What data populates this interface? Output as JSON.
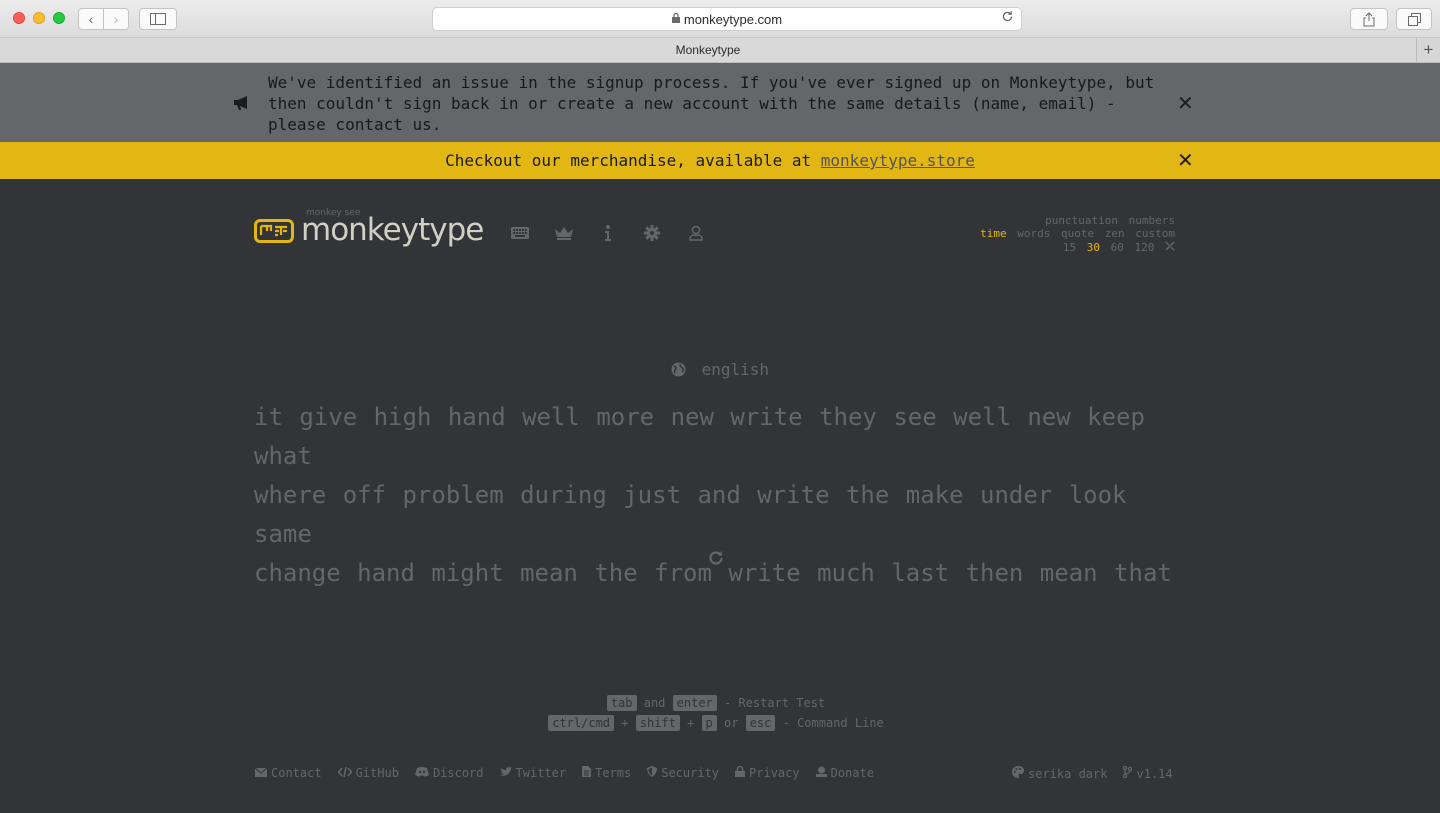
{
  "browser": {
    "url": "monkeytype.com",
    "tab_title": "Monkeytype",
    "back_glyph": "‹",
    "forward_glyph": "›",
    "new_tab_glyph": "+"
  },
  "notice": {
    "text": "We've identified an issue in the signup process. If you've ever signed up on Monkeytype, but then couldn't sign back in or create a new account with the same details (name, email) - please contact us.",
    "close": "✕",
    "icon": "megaphone-icon"
  },
  "merch": {
    "text": "Checkout our merchandise, available at ",
    "link": "monkeytype.store",
    "close": "✕"
  },
  "header": {
    "logo_top": "monkey see",
    "logo_text": "monkeytype"
  },
  "config": {
    "punctuation": "punctuation",
    "numbers": "numbers",
    "modes": [
      "time",
      "words",
      "quote",
      "zen",
      "custom"
    ],
    "active_mode": "time",
    "times": [
      "15",
      "30",
      "60",
      "120"
    ],
    "active_time": "30"
  },
  "test": {
    "language": "english",
    "lines": [
      "it give high hand well more new write they see well new keep what",
      "where off problem during just and write the make under look same",
      "change hand might mean the from write much last then mean that"
    ]
  },
  "hints": {
    "line1": {
      "key1": "tab",
      "and": "and",
      "key2": "enter",
      "desc": "- Restart Test"
    },
    "line2": {
      "key1": "ctrl/cmd",
      "plus1": "+",
      "key2": "shift",
      "plus2": "+",
      "key3": "p",
      "or": "or",
      "key4": "esc",
      "desc": "- Command Line"
    }
  },
  "footer": {
    "links": [
      "Contact",
      "GitHub",
      "Discord",
      "Twitter",
      "Terms",
      "Security",
      "Privacy",
      "Donate"
    ],
    "theme": "serika dark",
    "version": "v1.14"
  },
  "colors": {
    "bg": "#323437",
    "main": "#e2b714",
    "sub": "#646669",
    "text": "#d1d0c5"
  }
}
